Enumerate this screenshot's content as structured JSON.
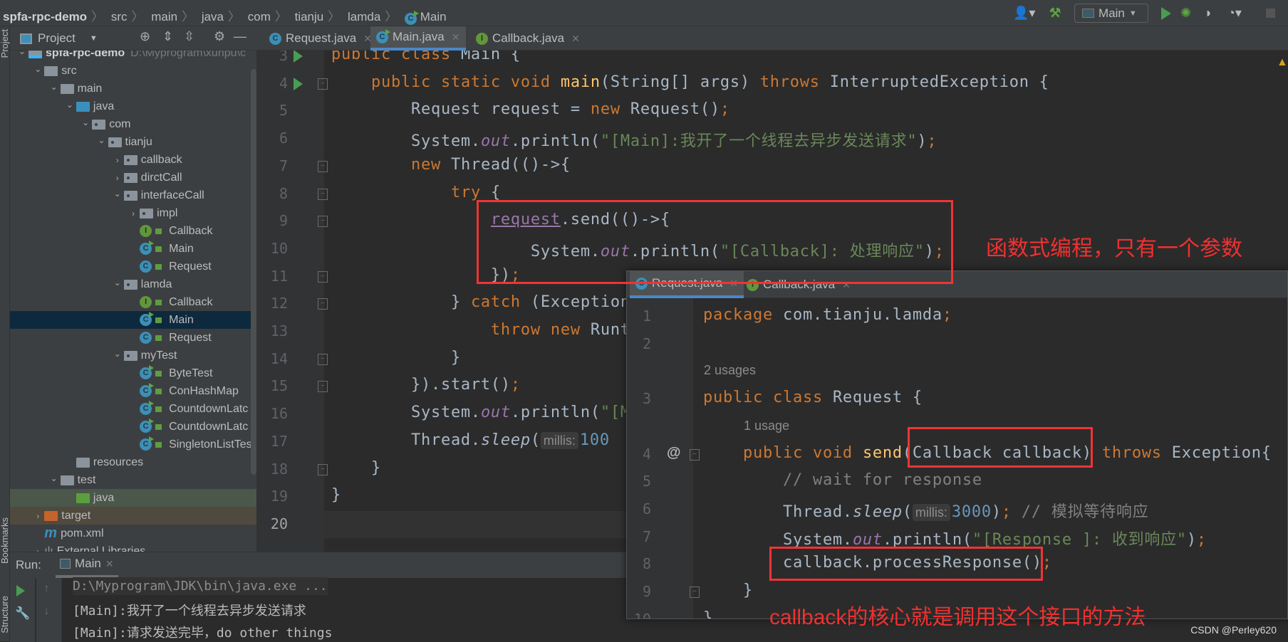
{
  "breadcrumb": {
    "project": "spfa-rpc-demo",
    "items": [
      "src",
      "main",
      "java",
      "com",
      "tianju",
      "lamda",
      "Main"
    ]
  },
  "toolbar": {
    "run_config": "Main",
    "icons": [
      "user-icon",
      "build-hammer-icon",
      "run-icon",
      "debug-icon",
      "coverage-icon",
      "profile-icon",
      "stop-icon"
    ]
  },
  "project_panel": {
    "title": "Project",
    "strip_label": "Project",
    "bookmarks_label": "Bookmarks",
    "structure_label": "Structure",
    "tree": [
      {
        "label": "spfa-rpc-demo",
        "path": "D:\\Myprogram\\xunpu\\c",
        "depth": 0,
        "type": "module",
        "open": true
      },
      {
        "label": "src",
        "depth": 1,
        "type": "folder",
        "open": true
      },
      {
        "label": "main",
        "depth": 2,
        "type": "folder",
        "open": true
      },
      {
        "label": "java",
        "depth": 3,
        "type": "source",
        "open": true
      },
      {
        "label": "com",
        "depth": 4,
        "type": "package",
        "open": true
      },
      {
        "label": "tianju",
        "depth": 5,
        "type": "package",
        "open": true
      },
      {
        "label": "callback",
        "depth": 6,
        "type": "package",
        "open": false
      },
      {
        "label": "dirctCall",
        "depth": 6,
        "type": "package",
        "open": false
      },
      {
        "label": "interfaceCall",
        "depth": 6,
        "type": "package",
        "open": true
      },
      {
        "label": "impl",
        "depth": 7,
        "type": "package",
        "open": false
      },
      {
        "label": "Callback",
        "depth": 7,
        "type": "interface"
      },
      {
        "label": "Main",
        "depth": 7,
        "type": "class-run"
      },
      {
        "label": "Request",
        "depth": 7,
        "type": "class"
      },
      {
        "label": "lamda",
        "depth": 6,
        "type": "package",
        "open": true
      },
      {
        "label": "Callback",
        "depth": 7,
        "type": "interface"
      },
      {
        "label": "Main",
        "depth": 7,
        "type": "class-run",
        "selected": true
      },
      {
        "label": "Request",
        "depth": 7,
        "type": "class"
      },
      {
        "label": "myTest",
        "depth": 6,
        "type": "package",
        "open": true
      },
      {
        "label": "ByteTest",
        "depth": 7,
        "type": "class-run"
      },
      {
        "label": "ConHashMap",
        "depth": 7,
        "type": "class-run"
      },
      {
        "label": "CountdownLatc",
        "depth": 7,
        "type": "class-run"
      },
      {
        "label": "CountdownLatc",
        "depth": 7,
        "type": "class-run"
      },
      {
        "label": "SingletonListTes",
        "depth": 7,
        "type": "class-run"
      },
      {
        "label": "resources",
        "depth": 3,
        "type": "resources"
      },
      {
        "label": "test",
        "depth": 2,
        "type": "folder",
        "open": true
      },
      {
        "label": "java",
        "depth": 3,
        "type": "test-source",
        "highlight": "green"
      },
      {
        "label": "target",
        "depth": 1,
        "type": "excluded",
        "open": false,
        "highlight": "brown"
      },
      {
        "label": "pom.xml",
        "depth": 1,
        "type": "maven"
      },
      {
        "label": "External Libraries",
        "depth": 1,
        "type": "libraries",
        "open": false
      }
    ]
  },
  "editor_tabs": [
    {
      "label": "Request.java",
      "icon": "class"
    },
    {
      "label": "Main.java",
      "icon": "class-run",
      "active": true
    },
    {
      "label": "Callback.java",
      "icon": "interface"
    }
  ],
  "main_code": [
    {
      "n": "3",
      "run": true,
      "t": [
        [
          "public class ",
          "kw"
        ],
        [
          "Main {",
          ""
        ]
      ]
    },
    {
      "n": "4",
      "run": true,
      "fold": true,
      "t": [
        [
          "    ",
          ""
        ],
        [
          "public static void ",
          "kw"
        ],
        [
          "main",
          "fn"
        ],
        [
          "(String[] args) ",
          ""
        ],
        [
          "throws ",
          "kw"
        ],
        [
          "InterruptedException {",
          ""
        ]
      ]
    },
    {
      "n": "5",
      "t": [
        [
          "        Request request = ",
          ""
        ],
        [
          "new ",
          "kw"
        ],
        [
          "Request()",
          ""
        ],
        [
          ";",
          "kw"
        ]
      ]
    },
    {
      "n": "6",
      "t": [
        [
          "        System.",
          ""
        ],
        [
          "out",
          "fld"
        ],
        [
          ".println(",
          ""
        ],
        [
          "\"[Main]:我开了一个线程去异步发送请求\"",
          "str"
        ],
        [
          ")",
          ""
        ],
        [
          ";",
          "kw"
        ]
      ]
    },
    {
      "n": "7",
      "fold": true,
      "t": [
        [
          "        ",
          ""
        ],
        [
          "new ",
          "kw"
        ],
        [
          "Thread(()->{",
          ""
        ]
      ]
    },
    {
      "n": "8",
      "fold": true,
      "t": [
        [
          "            ",
          ""
        ],
        [
          "try ",
          "kw"
        ],
        [
          "{",
          ""
        ]
      ]
    },
    {
      "n": "9",
      "fold": true,
      "t": [
        [
          "                ",
          ""
        ],
        [
          "request",
          "var"
        ],
        [
          ".send(()->{",
          ""
        ]
      ]
    },
    {
      "n": "10",
      "t": [
        [
          "                    System.",
          ""
        ],
        [
          "out",
          "fld"
        ],
        [
          ".println(",
          ""
        ],
        [
          "\"[Callback]: 处理响应\"",
          "str"
        ],
        [
          ")",
          ""
        ],
        [
          ";",
          "kw"
        ]
      ]
    },
    {
      "n": "11",
      "fold": true,
      "t": [
        [
          "                })",
          ""
        ],
        [
          ";",
          "kw"
        ]
      ]
    },
    {
      "n": "12",
      "fold": true,
      "t": [
        [
          "            } ",
          ""
        ],
        [
          "catch ",
          "kw"
        ],
        [
          "(Exception",
          ""
        ]
      ]
    },
    {
      "n": "13",
      "t": [
        [
          "                ",
          ""
        ],
        [
          "throw new ",
          "kw"
        ],
        [
          "Runt",
          ""
        ]
      ]
    },
    {
      "n": "14",
      "fold": true,
      "t": [
        [
          "            }",
          ""
        ]
      ]
    },
    {
      "n": "15",
      "fold": true,
      "t": [
        [
          "        }).start()",
          ""
        ],
        [
          ";",
          "kw"
        ]
      ]
    },
    {
      "n": "16",
      "t": [
        [
          "        System.",
          ""
        ],
        [
          "out",
          "fld"
        ],
        [
          ".println(",
          ""
        ],
        [
          "\"[M",
          "str"
        ]
      ]
    },
    {
      "n": "17",
      "t": [
        [
          "        Thread.",
          ""
        ],
        [
          "sleep",
          "it"
        ],
        [
          "(",
          ""
        ],
        [
          "millis:",
          "hint"
        ],
        [
          "100",
          "num"
        ]
      ]
    },
    {
      "n": "18",
      "fold": true,
      "t": [
        [
          "    }",
          ""
        ]
      ]
    },
    {
      "n": "19",
      "t": [
        [
          "}",
          ""
        ]
      ]
    },
    {
      "n": "20",
      "current": true,
      "t": []
    }
  ],
  "popup": {
    "tabs": [
      {
        "label": "Request.java",
        "icon": "class",
        "active": true
      },
      {
        "label": "Callback.java",
        "icon": "interface"
      }
    ],
    "lines": [
      {
        "n": "1",
        "t": [
          [
            "package ",
            "kw"
          ],
          [
            "com.tianju.lamda",
            ""
          ],
          [
            ";",
            "kw"
          ]
        ]
      },
      {
        "n": "2",
        "t": []
      },
      {
        "usage": "2 usages",
        "indent": 0
      },
      {
        "n": "3",
        "t": [
          [
            "public class ",
            "kw"
          ],
          [
            "Request {",
            ""
          ]
        ]
      },
      {
        "usage": "1 usage",
        "indent": 4
      },
      {
        "n": "4",
        "at": "@",
        "fold": true,
        "t": [
          [
            "    ",
            ""
          ],
          [
            "public void ",
            "kw"
          ],
          [
            "send",
            "fn"
          ],
          [
            "(Callback callback) ",
            ""
          ],
          [
            "throws ",
            "kw"
          ],
          [
            "Exception{",
            ""
          ]
        ]
      },
      {
        "n": "5",
        "t": [
          [
            "        ",
            ""
          ],
          [
            "// wait for response",
            "cmt"
          ]
        ]
      },
      {
        "n": "6",
        "t": [
          [
            "        Thread.",
            ""
          ],
          [
            "sleep",
            "it"
          ],
          [
            "(",
            ""
          ],
          [
            "millis:",
            "hint"
          ],
          [
            "3000",
            "num"
          ],
          [
            ")",
            ""
          ],
          [
            ";",
            "kw"
          ],
          [
            " // 模拟等待响应",
            "cmt"
          ]
        ]
      },
      {
        "n": "7",
        "t": [
          [
            "        System.",
            ""
          ],
          [
            "out",
            "fld"
          ],
          [
            ".println(",
            ""
          ],
          [
            "\"[Response ]: 收到响应\"",
            "str"
          ],
          [
            ")",
            ""
          ],
          [
            ";",
            "kw"
          ]
        ]
      },
      {
        "n": "8",
        "t": [
          [
            "        callback.processResponse()",
            ""
          ],
          [
            ";",
            "kw"
          ]
        ]
      },
      {
        "n": "9",
        "fold": true,
        "t": [
          [
            "    }",
            ""
          ]
        ]
      },
      {
        "n": "10",
        "t": [
          [
            "}",
            ""
          ]
        ]
      }
    ]
  },
  "annotations": {
    "lambda_note": "函数式编程，只有一个参数",
    "callback_note": "callback的核心就是调用这个接口的方法",
    "box_color": "#f03434"
  },
  "run_panel": {
    "label": "Run:",
    "tab": "Main",
    "output": [
      "D:\\Myprogram\\JDK\\bin\\java.exe ...",
      "[Main]:我开了一个线程去异步发送请求",
      "[Main]:请求发送完毕，do other things"
    ]
  },
  "watermark": "CSDN @Perley620",
  "colors": {
    "keyword": "#cc7832",
    "string": "#6a8759",
    "field": "#9876aa",
    "function": "#ffc66d",
    "number": "#6897bb",
    "run_green": "#499c54",
    "accent": "#4a88c7"
  }
}
